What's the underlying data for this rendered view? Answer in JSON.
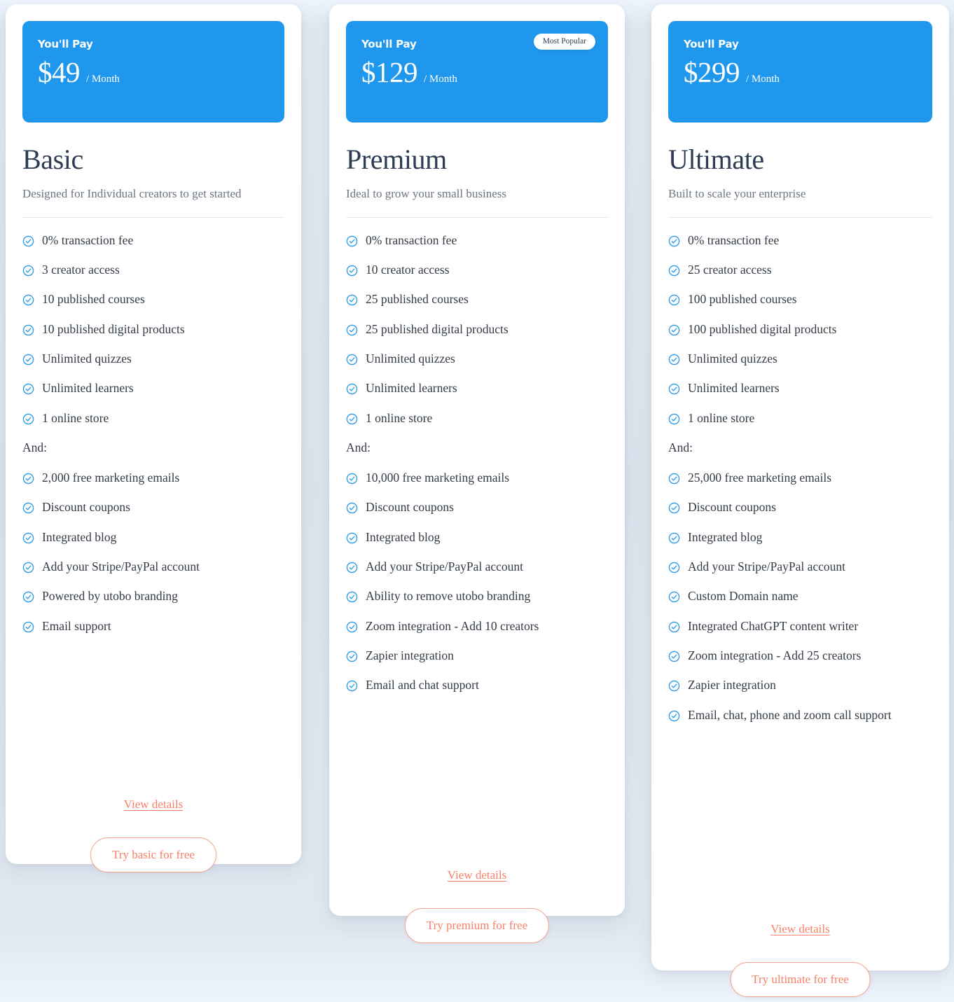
{
  "theme": {
    "page_background": "#eef4fc",
    "accent_blue": "#1f97ed",
    "accent_coral": "#f98068",
    "heading_color": "#2d3c52",
    "body_text_color": "#333b47",
    "muted_text_color": "#6c7683"
  },
  "common": {
    "pay_label": "You'll Pay",
    "period": "/ Month",
    "and_label": "And:",
    "view_details": "View details",
    "check_icon": "check-circle-icon"
  },
  "plans": [
    {
      "id": "basic",
      "pay_label": "You'll Pay",
      "price": "$49",
      "period": "/ Month",
      "badge": null,
      "title": "Basic",
      "subtitle": "Designed for Individual creators to get started",
      "features": [
        "0% transaction fee",
        "3 creator access",
        "10 published courses",
        "10 published digital products",
        "Unlimited quizzes",
        "Unlimited learners",
        "1 online store"
      ],
      "and_label": "And:",
      "extra_features": [
        "2,000 free marketing emails",
        "Discount coupons",
        "Integrated blog",
        "Add your Stripe/PayPal account",
        "Powered by utobo branding",
        "Email support"
      ],
      "view_details": "View details",
      "cta": "Try basic for free"
    },
    {
      "id": "premium",
      "pay_label": "You'll Pay",
      "price": "$129",
      "period": "/ Month",
      "badge": "Most Popular",
      "title": "Premium",
      "subtitle": "Ideal to grow your small business",
      "features": [
        "0% transaction fee",
        "10 creator access",
        "25 published courses",
        "25 published digital products",
        "Unlimited quizzes",
        "Unlimited learners",
        "1 online store"
      ],
      "and_label": "And:",
      "extra_features": [
        "10,000 free marketing emails",
        "Discount coupons",
        "Integrated blog",
        "Add your Stripe/PayPal account",
        "Ability to remove utobo branding",
        "Zoom integration - Add 10 creators",
        "Zapier integration",
        "Email and chat support"
      ],
      "view_details": "View details",
      "cta": "Try premium for free"
    },
    {
      "id": "ultimate",
      "pay_label": "You'll Pay",
      "price": "$299",
      "period": "/ Month",
      "badge": null,
      "title": "Ultimate",
      "subtitle": "Built to scale your enterprise",
      "features": [
        "0% transaction fee",
        "25 creator access",
        "100 published courses",
        "100 published digital products",
        "Unlimited quizzes",
        "Unlimited learners",
        "1 online store"
      ],
      "and_label": "And:",
      "extra_features": [
        "25,000 free marketing emails",
        "Discount coupons",
        "Integrated blog",
        "Add your Stripe/PayPal account",
        "Custom Domain name",
        "Integrated ChatGPT content writer",
        "Zoom integration - Add 25 creators",
        "Zapier integration",
        "Email, chat, phone and zoom call support"
      ],
      "view_details": "View details",
      "cta": "Try ultimate for free"
    }
  ]
}
